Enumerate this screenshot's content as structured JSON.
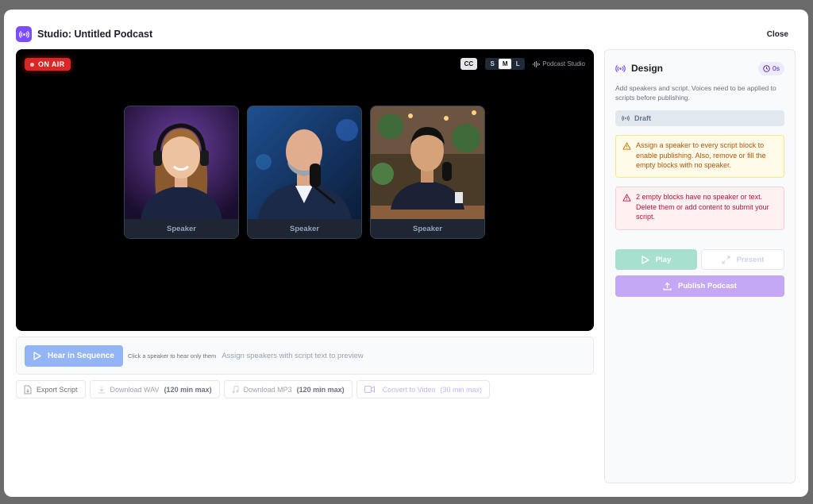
{
  "header": {
    "title": "Studio: Untitled Podcast",
    "close_label": "Close",
    "icon": "broadcast-icon"
  },
  "stage": {
    "on_air_label": "ON AIR",
    "cc_label": "CC",
    "sizes": [
      "S",
      "M",
      "L"
    ],
    "active_size": "M",
    "brand_label": "Podcast Studio",
    "speakers": [
      {
        "label": "Speaker"
      },
      {
        "label": "Speaker"
      },
      {
        "label": "Speaker"
      }
    ]
  },
  "playbar": {
    "hear_label": "Hear in Sequence",
    "hint_small": "Click a speaker to hear only them",
    "hint_main": "Assign speakers with script text to preview"
  },
  "actions": {
    "export": "Export Script",
    "wav": "Download WAV",
    "wav_limit": "(120 min max)",
    "mp3": "Download MP3",
    "mp3_limit": "(120 min max)",
    "video": "Convert to Video",
    "video_limit": "(30 min max)"
  },
  "side": {
    "title": "Design",
    "timer": "0s",
    "description": "Add speakers and script. Voices need to be applied to scripts before publishing.",
    "status": "Draft",
    "warning": "Assign a speaker to every script block to enable publishing. Also, remove or fill the empty blocks with no speaker.",
    "error": "2 empty blocks have no speaker or text. Delete them or add content to submit your script.",
    "play_label": "Play",
    "present_label": "Present",
    "publish_label": "Publish Podcast"
  },
  "colors": {
    "accent": "#7c4dff",
    "on_air": "#dc2626",
    "play": "#a7e0cf",
    "publish": "#c4a8f5",
    "hear": "#93b4f5"
  }
}
